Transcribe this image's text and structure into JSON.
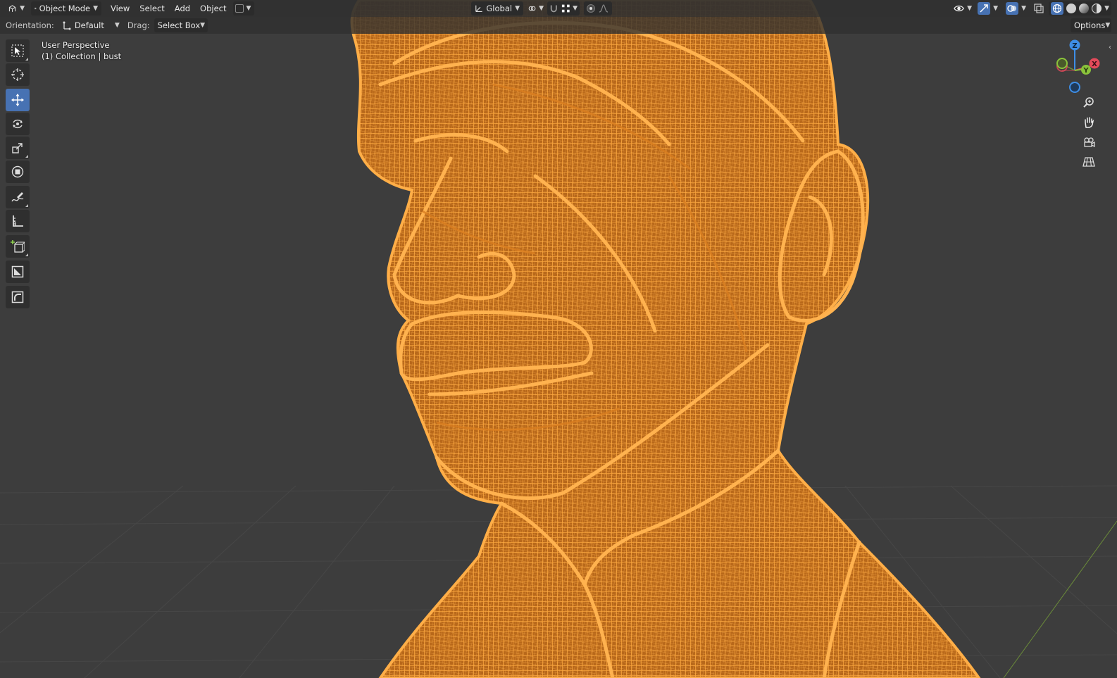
{
  "header": {
    "editor_type_icon": "viewport-3d-icon",
    "mode": {
      "label": "Object Mode",
      "icon": "object-mode-icon"
    },
    "menus": [
      "View",
      "Select",
      "Add",
      "Object"
    ],
    "transform_orientation": "Global",
    "shading_modes": [
      "wireframe",
      "solid",
      "material-preview",
      "rendered"
    ],
    "active_shading": "wireframe"
  },
  "tool_settings": {
    "orientation_label": "Orientation:",
    "orientation_value": "Default",
    "drag_label": "Drag:",
    "drag_value": "Select Box",
    "options_label": "Options"
  },
  "toolbar": {
    "tools": [
      {
        "name": "select-box-tool",
        "icon": "select-box-icon",
        "active": false
      },
      {
        "name": "cursor-tool",
        "icon": "cursor-icon",
        "active": false
      },
      {
        "name": "move-tool",
        "icon": "move-icon",
        "active": true
      },
      {
        "name": "rotate-tool",
        "icon": "rotate-icon",
        "active": false
      },
      {
        "name": "scale-tool",
        "icon": "scale-icon",
        "active": false
      },
      {
        "name": "transform-tool",
        "icon": "transform-icon",
        "active": false
      },
      {
        "name": "annotate-tool",
        "icon": "annotate-icon",
        "active": false
      },
      {
        "name": "measure-tool",
        "icon": "measure-icon",
        "active": false
      },
      {
        "name": "add-cube-tool",
        "icon": "add-cube-icon",
        "active": false
      },
      {
        "name": "extra-tool-1",
        "icon": "square-frame-icon",
        "active": false
      },
      {
        "name": "extra-tool-2",
        "icon": "curve-frame-icon",
        "active": false
      }
    ]
  },
  "viewport": {
    "perspective_label": "User Perspective",
    "collection_label": "(1) Collection | bust",
    "selected_object": "bust",
    "wire_color": "#f0952a",
    "background_color": "#3d3d3d"
  },
  "gizmo": {
    "axes": [
      "Z",
      "Y",
      "X"
    ],
    "x_color": "#e34a5a",
    "y_color": "#8ac33b",
    "z_color": "#3e8ee6"
  },
  "navigation": {
    "buttons": [
      "zoom-icon",
      "pan-hand-icon",
      "camera-view-icon",
      "ortho-grid-icon"
    ]
  }
}
